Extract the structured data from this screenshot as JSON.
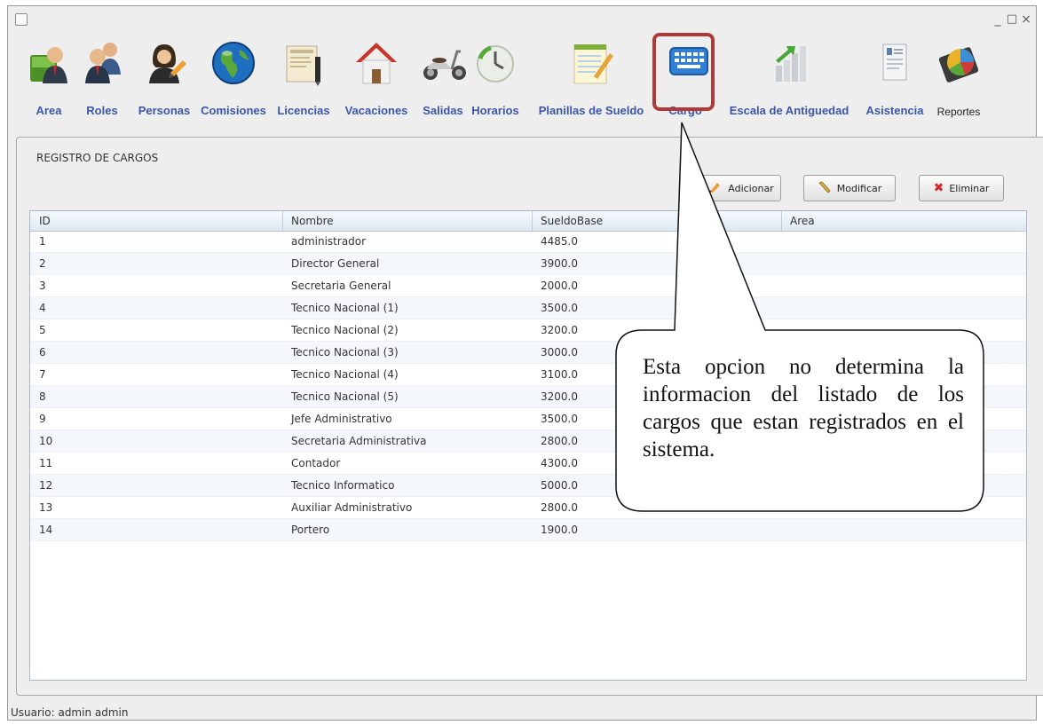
{
  "window": {
    "controls": {
      "minimize": "_",
      "maximize": "□",
      "close": "×"
    }
  },
  "toolbar": {
    "items": [
      {
        "label": "Area",
        "icon": "area-users-icon"
      },
      {
        "label": "Roles",
        "icon": "roles-users-icon"
      },
      {
        "label": "Personas",
        "icon": "person-edit-icon"
      },
      {
        "label": "Comisiones",
        "icon": "globe-icon"
      },
      {
        "label": "Licencias",
        "icon": "document-pen-icon"
      },
      {
        "label": "Vacaciones",
        "icon": "house-icon"
      },
      {
        "label": "Salidas",
        "icon": "scooter-icon"
      },
      {
        "label": "Horarios",
        "icon": "clock-icon"
      },
      {
        "label": "Planillas de Sueldo",
        "icon": "notepad-icon"
      },
      {
        "label": "Cargo",
        "icon": "keyboard-icon"
      },
      {
        "label": "Escala de Antiguedad",
        "icon": "bar-chart-icon"
      },
      {
        "label": "Asistencia",
        "icon": "report-document-icon"
      },
      {
        "label": "Reportes",
        "icon": "pie-chart-icon"
      }
    ]
  },
  "panel": {
    "title": "REGISTRO DE CARGOS",
    "buttons": {
      "add": "Adicionar",
      "edit": "Modificar",
      "delete": "Eliminar"
    }
  },
  "table": {
    "columns": [
      "ID",
      "Nombre",
      "SueldoBase",
      "Area"
    ],
    "rows": [
      [
        "1",
        "administrador",
        "4485.0",
        ""
      ],
      [
        "2",
        "Director General",
        "3900.0",
        ""
      ],
      [
        "3",
        "Secretaria General",
        "2000.0",
        ""
      ],
      [
        "4",
        "Tecnico Nacional (1)",
        "3500.0",
        ""
      ],
      [
        "5",
        "Tecnico Nacional (2)",
        "3200.0",
        ""
      ],
      [
        "6",
        "Tecnico Nacional (3)",
        "3000.0",
        ""
      ],
      [
        "7",
        "Tecnico Nacional (4)",
        "3100.0",
        ""
      ],
      [
        "8",
        "Tecnico Nacional (5)",
        "3200.0",
        ""
      ],
      [
        "9",
        "Jefe Administrativo",
        "3500.0",
        ""
      ],
      [
        "10",
        "Secretaria Administrativa",
        "2800.0",
        ""
      ],
      [
        "11",
        "Contador",
        "4300.0",
        ""
      ],
      [
        "12",
        "Tecnico Informatico",
        "5000.0",
        ""
      ],
      [
        "13",
        "Auxiliar Administrativo",
        "2800.0",
        ""
      ],
      [
        "14",
        "Portero",
        "1900.0",
        ""
      ]
    ]
  },
  "status": {
    "user": "Usuario: admin admin"
  },
  "annotation": {
    "text": "Esta opcion no determina la informacion del listado de los cargos que estan registrados en el sistema."
  },
  "colors": {
    "label_blue": "#3a56a8",
    "highlight_red": "#b03a3a"
  }
}
